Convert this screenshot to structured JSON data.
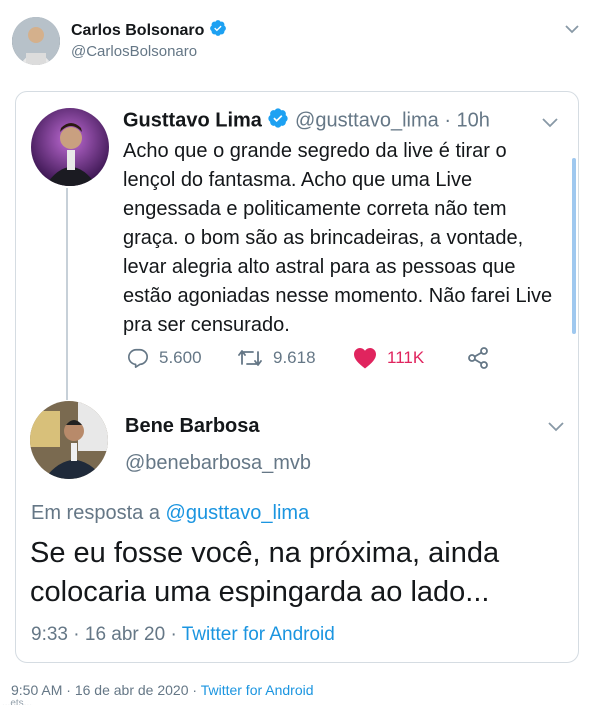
{
  "outer_tweet": {
    "author_name": "Carlos Bolsonaro",
    "author_handle": "@CarlosBolsonaro",
    "timestamp": "9:50 AM",
    "date": "16 de abr de 2020",
    "separator": "·",
    "source": "Twitter for Android",
    "footer_cutoff": "...ets..."
  },
  "quoted_thread": {
    "original": {
      "author_name": "Gusttavo Lima",
      "author_handle": "@gusttavo_lima",
      "separator": "·",
      "time_ago": "10h",
      "text": "Acho que o grande segredo da live é tirar o lençol do fantasma. Acho que uma Live engessada e politicamente correta não tem graça. o bom são as brincadeiras, a vontade, levar alegria alto astral para as pessoas que estão agoniadas nesse momento. Não farei Live pra ser censurado.",
      "replies": "5.600",
      "retweets": "9.618",
      "likes": "111K"
    },
    "reply": {
      "author_name": "Bene Barbosa",
      "author_handle": "@benebarbosa_mvb",
      "reply_prefix": "Em resposta a",
      "reply_to": "@gusttavo_lima",
      "text": "Se eu fosse você, na próxima, ainda colocaria uma espingarda ao lado...",
      "time": "9:33",
      "separator": "·",
      "date": "16 abr 20",
      "source_separator": "·",
      "source": "Twitter for Android"
    }
  },
  "colors": {
    "accent": "#1b95e0",
    "like": "#e0245e",
    "muted": "#657786",
    "text": "#14171a",
    "border": "#d5dce2"
  },
  "icons": [
    "verified-badge-icon",
    "chevron-down-icon",
    "reply-icon",
    "retweet-icon",
    "heart-icon",
    "share-icon"
  ]
}
